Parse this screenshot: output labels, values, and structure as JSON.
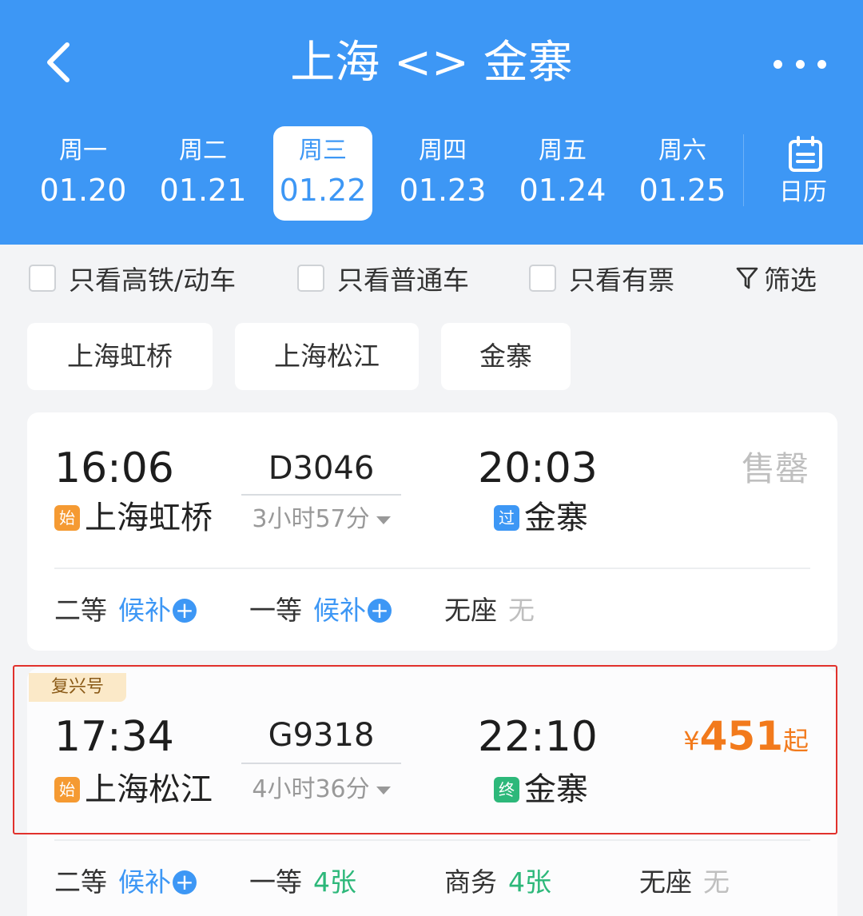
{
  "header": {
    "title": "上海 <> 金寨",
    "back_icon": "chevron-left-icon",
    "more_icon": "more-dots-icon",
    "dates": [
      {
        "weekday": "周一",
        "date": "01.20",
        "active": false
      },
      {
        "weekday": "周二",
        "date": "01.21",
        "active": false
      },
      {
        "weekday": "周三",
        "date": "01.22",
        "active": true
      },
      {
        "weekday": "周四",
        "date": "01.23",
        "active": false
      },
      {
        "weekday": "周五",
        "date": "01.24",
        "active": false
      },
      {
        "weekday": "周六",
        "date": "01.25",
        "active": false
      }
    ],
    "calendar_label": "日历"
  },
  "filters": {
    "only_high_speed": "只看高铁/动车",
    "only_regular": "只看普通车",
    "only_available": "只看有票",
    "filter_label": "筛选"
  },
  "stations": [
    "上海虹桥",
    "上海松江",
    "金寨"
  ],
  "trains": [
    {
      "depart_time": "16:06",
      "train_no": "D3046",
      "arrive_time": "20:03",
      "duration": "3小时57分",
      "from_badge": "始",
      "from_station": "上海虹桥",
      "to_badge": "过",
      "to_station": "金寨",
      "status": "售罄",
      "seats": [
        {
          "class": "二等",
          "status": "候补"
        },
        {
          "class": "一等",
          "status": "候补"
        },
        {
          "class": "无座",
          "status": "无"
        }
      ]
    },
    {
      "tag": "复兴号",
      "depart_time": "17:34",
      "train_no": "G9318",
      "arrive_time": "22:10",
      "duration": "4小时36分",
      "from_badge": "始",
      "from_station": "上海松江",
      "to_badge": "终",
      "to_station": "金寨",
      "price_symbol": "¥",
      "price": "451",
      "price_suffix": "起",
      "seats": [
        {
          "class": "二等",
          "status": "候补"
        },
        {
          "class": "一等",
          "status": "4张"
        },
        {
          "class": "商务",
          "status": "4张"
        },
        {
          "class": "无座",
          "status": "无"
        }
      ]
    }
  ],
  "colors": {
    "header_bg": "#3d97f5",
    "price": "#f27a1c",
    "waitlist": "#3d97f5",
    "available": "#2db87a",
    "highlight_border": "#e1312c"
  }
}
